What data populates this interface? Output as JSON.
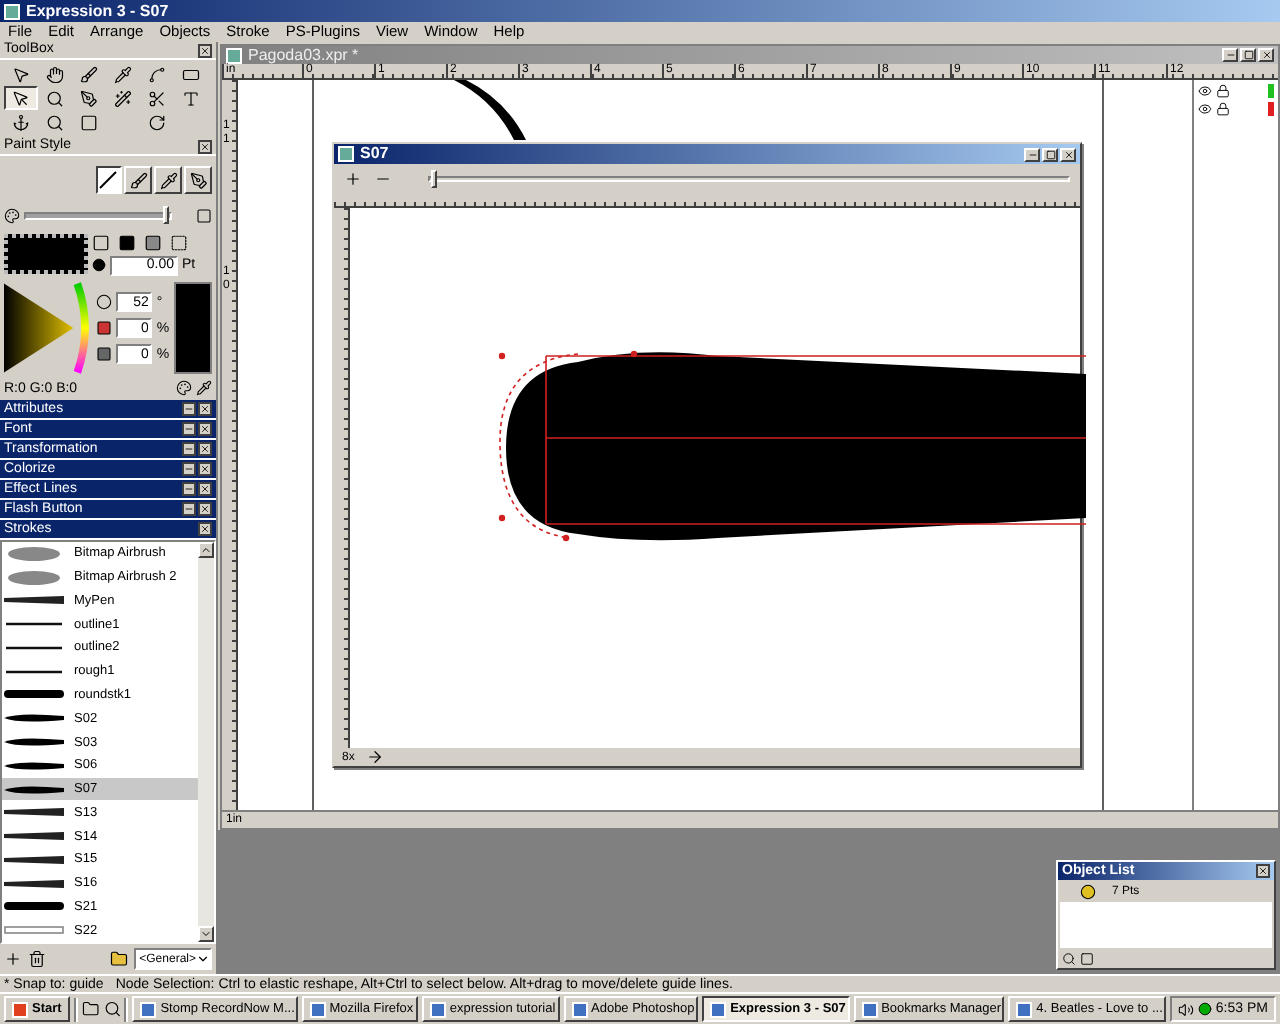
{
  "window": {
    "title": "Expression 3 - S07"
  },
  "menu": [
    "File",
    "Edit",
    "Arrange",
    "Objects",
    "Stroke",
    "PS-Plugins",
    "View",
    "Window",
    "Help"
  ],
  "toolbox": {
    "title": "ToolBox",
    "tools": [
      {
        "kind": "arrow",
        "selected": false
      },
      {
        "kind": "hand",
        "selected": false
      },
      {
        "kind": "brush",
        "selected": false
      },
      {
        "kind": "pipette",
        "selected": false
      },
      {
        "kind": "spline",
        "selected": false
      },
      {
        "kind": "frame",
        "selected": false
      },
      {
        "kind": "select",
        "selected": true
      },
      {
        "kind": "zoom",
        "selected": false
      },
      {
        "kind": "pen",
        "selected": false
      },
      {
        "kind": "wand",
        "selected": false
      },
      {
        "kind": "scissors",
        "selected": false
      },
      {
        "kind": "text",
        "selected": false
      },
      {
        "kind": "anchor",
        "selected": false
      },
      {
        "kind": "lens",
        "selected": false
      },
      {
        "kind": "rect",
        "selected": false
      },
      {
        "kind": "blank",
        "selected": false
      },
      {
        "kind": "rotate",
        "selected": false
      },
      {
        "kind": "blank",
        "selected": false
      }
    ]
  },
  "paint_style": {
    "title": "Paint Style",
    "opacity": {
      "level": 1
    },
    "width_value": "0.00",
    "width_unit": "Pt",
    "hue": "52",
    "hue_unit": "°",
    "saturation": "0",
    "saturation_unit": "%",
    "brightness": "0",
    "brightness_unit": "%",
    "rgb": "R:0 G:0 B:0"
  },
  "panels": [
    {
      "title": "Attributes",
      "expanded": false
    },
    {
      "title": "Font",
      "expanded": false
    },
    {
      "title": "Transformation",
      "expanded": false
    },
    {
      "title": "Colorize",
      "expanded": false
    },
    {
      "title": "Effect Lines",
      "expanded": false
    },
    {
      "title": "Flash Button",
      "expanded": false
    },
    {
      "title": "Strokes",
      "expanded": true
    }
  ],
  "strokes": {
    "items": [
      {
        "name": "Bitmap Airbrush",
        "kind": "airbrush",
        "selected": false
      },
      {
        "name": "Bitmap Airbrush 2",
        "kind": "airbrush",
        "selected": false
      },
      {
        "name": "MyPen",
        "kind": "textured",
        "selected": false
      },
      {
        "name": "outline1",
        "kind": "thin",
        "selected": false
      },
      {
        "name": "outline2",
        "kind": "thin",
        "selected": false
      },
      {
        "name": "rough1",
        "kind": "thin",
        "selected": false
      },
      {
        "name": "roundstk1",
        "kind": "solid",
        "selected": false
      },
      {
        "name": "S02",
        "kind": "taper",
        "selected": false
      },
      {
        "name": "S03",
        "kind": "taper",
        "selected": false
      },
      {
        "name": "S06",
        "kind": "taper",
        "selected": false
      },
      {
        "name": "S07",
        "kind": "taper",
        "selected": true
      },
      {
        "name": "S13",
        "kind": "textured",
        "selected": false
      },
      {
        "name": "S14",
        "kind": "textured",
        "selected": false
      },
      {
        "name": "S15",
        "kind": "textured",
        "selected": false
      },
      {
        "name": "S16",
        "kind": "textured",
        "selected": false
      },
      {
        "name": "S21",
        "kind": "solid",
        "selected": false
      },
      {
        "name": "S22",
        "kind": "hollow",
        "selected": false
      }
    ],
    "library": "<General>"
  },
  "document": {
    "title": "Pagoda03.xpr *",
    "ruler_unit": "in",
    "ruler_labels": [
      "0",
      "1",
      "2",
      "3",
      "4",
      "5",
      "6",
      "7",
      "8",
      "9",
      "10",
      "11",
      "12"
    ],
    "vertical_labels": [
      "11",
      "10"
    ],
    "scroll_label": "1in",
    "layers": [
      {
        "color": "#20c020"
      },
      {
        "color": "#e02020"
      }
    ]
  },
  "stroke_window": {
    "title": "S07",
    "zoom": "8x",
    "level": 0
  },
  "object_list": {
    "title": "Object List",
    "items": [
      {
        "label": "7 Pts",
        "selected": true
      }
    ]
  },
  "status_bar": {
    "snap": "* Snap to: guide",
    "hint": "Node Selection: Ctrl to elastic reshape, Alt+Ctrl to select below. Alt+drag to move/delete guide lines."
  },
  "taskbar": {
    "start": "Start",
    "tasks": [
      {
        "label": "Stomp RecordNow M...",
        "selected": false
      },
      {
        "label": "Mozilla Firefox",
        "selected": false
      },
      {
        "label": "expression tutorial",
        "selected": false
      },
      {
        "label": "Adobe Photoshop",
        "selected": false
      },
      {
        "label": "Expression 3 - S07",
        "selected": true
      },
      {
        "label": "Bookmarks Manager",
        "selected": false
      },
      {
        "label": "4. Beatles - Love to ...",
        "selected": false
      }
    ],
    "clock": "6:53 PM"
  }
}
